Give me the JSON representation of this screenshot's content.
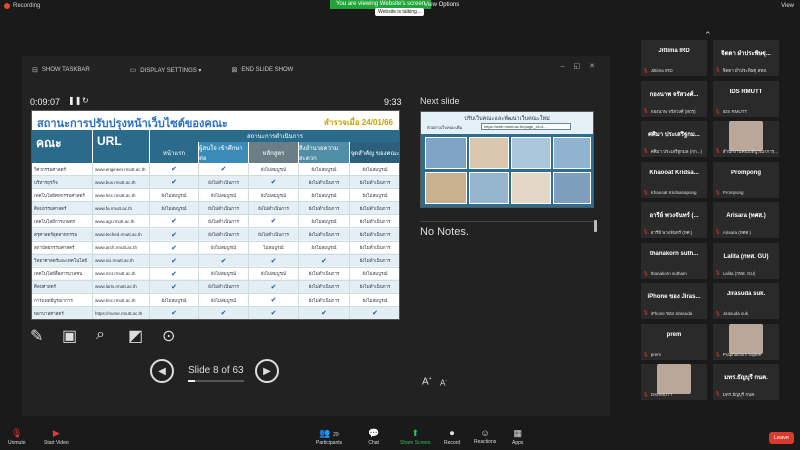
{
  "topbar": {
    "recording": "Recording",
    "banner": "You are viewing Website's screen",
    "view_options": "View Options",
    "talking": "Website is talking...",
    "view": "View"
  },
  "presenter": {
    "toolbar": {
      "show_taskbar": "SHOW TASKBAR",
      "display_settings": "DISPLAY SETTINGS ▾",
      "end_show": "END SLIDE SHOW"
    },
    "timer": "0:09:07",
    "clock": "9:33",
    "next_slide": "Next slide",
    "notes": "No Notes.",
    "slide_count": "Slide 8 of 63",
    "progress": 0.127
  },
  "slide": {
    "title": "สถานะการปรับปรุงหน้าเว็บไซต์ของคณะ",
    "date": "สำรวจเมื่อ 24/01/66",
    "col_faculty": "คณะ",
    "col_url": "URL",
    "col_status": "สถานะการดำเนินการ",
    "sub_cols": [
      "หน้าแรก",
      "ผู้สนใจ\nเข้าศึกษาต่อ",
      "หลักสูตร",
      "สิ่งอำนวยความสะดวก",
      "จุดสำคัญ\nของคณะ"
    ],
    "rows": [
      [
        "วิศวกรรมศาสตร์",
        "www.engineer.rmutt.ac.th",
        "✔",
        "✔",
        "ยังไม่สมบูรณ์",
        "ยังไม่สมบูรณ์",
        "ยังไม่สมบูรณ์"
      ],
      [
        "บริหารธุรกิจ",
        "www.bus.rmutt.ac.th",
        "✔",
        "ยังไม่ดำเนินการ",
        "✔",
        "ยังไม่ดำเนินการ",
        "ยังไม่ดำเนินการ"
      ],
      [
        "เทคโนโลยีคหกรรมศาสตร์",
        "www.hec.rmutt.ac.th",
        "ยังไม่สมบูรณ์",
        "ยังไม่สมบูรณ์",
        "ยังไม่สมบูรณ์",
        "ยังไม่สมบูรณ์",
        "ยังไม่สมบูรณ์"
      ],
      [
        "ศิลปกรรมศาสตร์",
        "www.fa.rmutt.ac.th",
        "ยังไม่สมบูรณ์",
        "ยังไม่ดำเนินการ",
        "ยังไม่ดำเนินการ",
        "ยังไม่ดำเนินการ",
        "ยังไม่ดำเนินการ"
      ],
      [
        "เทคโนโลยีการเกษตร",
        "www.agr.rmutt.ac.th",
        "✔",
        "ยังไม่ดำเนินการ",
        "✔",
        "ยังไม่สมบูรณ์",
        "ยังไม่ดำเนินการ"
      ],
      [
        "ครุศาสตร์อุตสาหกรรม",
        "www.teched.rmutt.ac.th",
        "✔",
        "ยังไม่ดำเนินการ",
        "ยังไม่ดำเนินการ",
        "ยังไม่ดำเนินการ",
        "ยังไม่ดำเนินการ"
      ],
      [
        "สถาปัตยกรรมศาสตร์",
        "www.arch.rmutt.ac.th",
        "✔",
        "ยังไม่สมบูรณ์",
        "ไม่สมบูรณ์",
        "ยังไม่สมบูรณ์",
        "ยังไม่ดำเนินการ"
      ],
      [
        "วิทยาศาสตร์และเทคโนโลยี",
        "www.sci.rmutt.ac.th",
        "✔",
        "✔",
        "✔",
        "✔",
        "ยังไม่ดำเนินการ"
      ],
      [
        "เทคโนโลยีสื่อสารมวลชน",
        "www.mct.rmutt.ac.th",
        "✔",
        "ยังไม่สมบูรณ์",
        "ยังไม่สมบูรณ์",
        "ยังไม่ดำเนินการ",
        "ยังไม่สมบูรณ์"
      ],
      [
        "ศิลปศาสตร์",
        "www.larts.rmutt.ac.th",
        "✔",
        "ยังไม่ดำเนินการ",
        "✔",
        "ยังไม่ดำเนินการ",
        "ยังไม่ดำเนินการ"
      ],
      [
        "การแพทย์บูรณาการ",
        "www.tmc.rmutt.ac.th",
        "ยังไม่สมบูรณ์",
        "ยังไม่สมบูรณ์",
        "✔",
        "ยังไม่ดำเนินการ",
        "ยังไม่สมบูรณ์"
      ],
      [
        "พยาบาลศาสตร์",
        "https://nurse.rmutt.ac.th",
        "✔",
        "✔",
        "✔",
        "✔",
        "✔"
      ]
    ]
  },
  "next_slide": {
    "title": "ปรับเว็บคณะและพัฒนาเว็บคณะใหม่",
    "url_label": "ตัวอย่างเว็บคณะเพิ่ม",
    "url": "https://web.rmutt.ac.th/page_id=4..."
  },
  "participants": [
    {
      "big": "Jittima IRD",
      "small": "Jittima IRD"
    },
    {
      "big": "จิตดา ผำประพิษฐุ...",
      "small": "จิตดา ผำประพิษฐุ สทส."
    },
    {
      "big": "กองนาพ จรัสวงศ์...",
      "small": "กองนาพ จรัสวงศ์ (สถร)"
    },
    {
      "big": "IDS RMUTT",
      "small": "IDS RMUTT"
    },
    {
      "big": "ศศิมา ประเสริฐกม...",
      "small": "ศศิมา ประเสริฐกมล (กก...)"
    },
    {
      "big": "",
      "small": "สำนักงานคณบดีบูรณาการ...",
      "photo": true
    },
    {
      "big": "Khaooat Kridsa...",
      "small": "Khaooat Kridsanapong"
    },
    {
      "big": "Prompong",
      "small": "Prompong"
    },
    {
      "big": "อารีย์ พวงจันทร์ (...",
      "small": "อารีย์ พวงจันทร์ (ทศ.)"
    },
    {
      "big": "Arisara (ทศส.)",
      "small": "Arisara (ทศส.)"
    },
    {
      "big": "thanakorn  suth...",
      "small": "thanakorn  sutham"
    },
    {
      "big": "Lalita (กทส. GU)",
      "small": "Lalita (กทส. GU)"
    },
    {
      "big": "iPhone ของ Jiras...",
      "small": "iPhone ของ Jirasuda"
    },
    {
      "big": "Jirasuda suk.",
      "small": "Jirasuda suk."
    },
    {
      "big": "prem",
      "small": "prem"
    },
    {
      "big": "",
      "small": "Praphatsorn Nijdee",
      "photo": true
    },
    {
      "big": "",
      "small": "DSRMUTT",
      "photo": true
    },
    {
      "big": "มทร.ธัญบุรี กนค.",
      "small": "มทร.ธัญบุรี กนค."
    }
  ],
  "bottom": {
    "unmute": "Unmute",
    "start_video": "Start Video",
    "participants": "Participants",
    "participants_count": "29",
    "chat": "Chat",
    "share_screen": "Share Screen",
    "record": "Record",
    "reactions": "Reactions",
    "apps": "Apps",
    "leave": "Leave"
  }
}
